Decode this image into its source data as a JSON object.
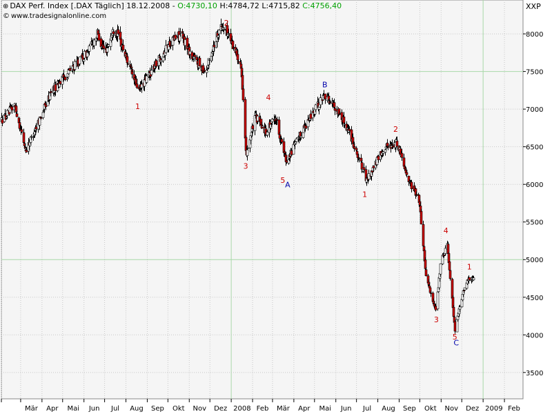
{
  "header": {
    "pin_icon": "pin-icon",
    "title": "DAX Perf. Index [.DAX  Täglich] 18.12.2008",
    "open": "O:4730,10",
    "high": "H:4784,72",
    "low": "L:4715,82",
    "close": "C:4756,40"
  },
  "source": {
    "copyright_icon": "copyright-icon",
    "text": "www.tradesignalonline.com"
  },
  "axis_corner_label": "XXP",
  "colors": {
    "up": "#ffffff",
    "down": "#cc0000",
    "wick": "#000000",
    "wave_label": "#cc0000",
    "abc_label": "#0000aa",
    "grid": "#c8c8c8",
    "plot_bg": "#f5f5f5",
    "hline": "#a8d8a8"
  },
  "chart_data": {
    "type": "candlestick",
    "y_ticks": [
      3500,
      4000,
      4500,
      5000,
      5500,
      6000,
      6500,
      7000,
      7500,
      8000
    ],
    "ylim": [
      3150,
      8450
    ],
    "x_tick_labels": [
      "Mär",
      "Apr",
      "Mai",
      "Jun",
      "Jul",
      "Aug",
      "Sep",
      "Okt",
      "Nov",
      "Dez",
      "2008",
      "Feb",
      "Mär",
      "Apr",
      "Mai",
      "Jun",
      "Jul",
      "Aug",
      "Sep",
      "Okt",
      "Nov",
      "Dez",
      "2009",
      "Feb"
    ],
    "horizontal_lines": [
      7500,
      5000
    ],
    "x_start": "2007-02-01",
    "x_end": "2009-02-28",
    "price_path": [
      [
        "2007-02-01",
        6850
      ],
      [
        "2007-02-20",
        7050
      ],
      [
        "2007-03-08",
        6450
      ],
      [
        "2007-03-20",
        6700
      ],
      [
        "2007-04-15",
        7250
      ],
      [
        "2007-05-10",
        7500
      ],
      [
        "2007-06-05",
        7750
      ],
      [
        "2007-06-20",
        8000
      ],
      [
        "2007-07-01",
        7750
      ],
      [
        "2007-07-15",
        8100
      ],
      [
        "2007-08-10",
        7450
      ],
      [
        "2007-08-20",
        7250
      ],
      [
        "2007-09-10",
        7550
      ],
      [
        "2007-10-05",
        7900
      ],
      [
        "2007-10-20",
        8000
      ],
      [
        "2007-11-05",
        7700
      ],
      [
        "2007-11-25",
        7500
      ],
      [
        "2007-12-15",
        8100
      ],
      [
        "2007-12-25",
        8050
      ],
      [
        "2008-01-15",
        7600
      ],
      [
        "2008-01-22",
        6400
      ],
      [
        "2008-02-05",
        6900
      ],
      [
        "2008-02-20",
        6700
      ],
      [
        "2008-03-05",
        6900
      ],
      [
        "2008-03-20",
        6300
      ],
      [
        "2008-04-15",
        6750
      ],
      [
        "2008-05-15",
        7200
      ],
      [
        "2008-06-05",
        6950
      ],
      [
        "2008-06-20",
        6700
      ],
      [
        "2008-07-15",
        6050
      ],
      [
        "2008-08-10",
        6500
      ],
      [
        "2008-08-30",
        6550
      ],
      [
        "2008-09-15",
        6050
      ],
      [
        "2008-09-30",
        5800
      ],
      [
        "2008-10-10",
        4800
      ],
      [
        "2008-10-24",
        4300
      ],
      [
        "2008-11-01",
        5000
      ],
      [
        "2008-11-10",
        5200
      ],
      [
        "2008-11-21",
        4050
      ],
      [
        "2008-12-01",
        4500
      ],
      [
        "2008-12-10",
        4750
      ],
      [
        "2008-12-18",
        4756
      ]
    ],
    "last_candle": {
      "date": "2008-12-18",
      "open": 4730.1,
      "high": 4784.72,
      "low": 4715.82,
      "close": 4756.4
    },
    "wave_labels": [
      {
        "text": "1",
        "date": "2007-08-18",
        "y": 7000,
        "color": "red"
      },
      {
        "text": "2",
        "date": "2007-12-25",
        "y": 8110,
        "color": "red"
      },
      {
        "text": "3",
        "date": "2008-01-22",
        "y": 6210,
        "color": "red"
      },
      {
        "text": "4",
        "date": "2008-02-24",
        "y": 7120,
        "color": "red"
      },
      {
        "text": "5",
        "date": "2008-03-16",
        "y": 6020,
        "color": "red"
      },
      {
        "text": "A",
        "date": "2008-03-23",
        "y": 5960,
        "color": "blue"
      },
      {
        "text": "B",
        "date": "2008-05-16",
        "y": 7290,
        "color": "blue"
      },
      {
        "text": "1",
        "date": "2008-07-13",
        "y": 5830,
        "color": "red"
      },
      {
        "text": "2",
        "date": "2008-08-27",
        "y": 6700,
        "color": "red"
      },
      {
        "text": "3",
        "date": "2008-10-25",
        "y": 4170,
        "color": "red"
      },
      {
        "text": "4",
        "date": "2008-11-08",
        "y": 5350,
        "color": "red"
      },
      {
        "text": "5",
        "date": "2008-11-21",
        "y": 3940,
        "color": "red"
      },
      {
        "text": "C",
        "date": "2008-11-23",
        "y": 3860,
        "color": "blue"
      },
      {
        "text": "1",
        "date": "2008-12-12",
        "y": 4870,
        "color": "red"
      }
    ]
  }
}
